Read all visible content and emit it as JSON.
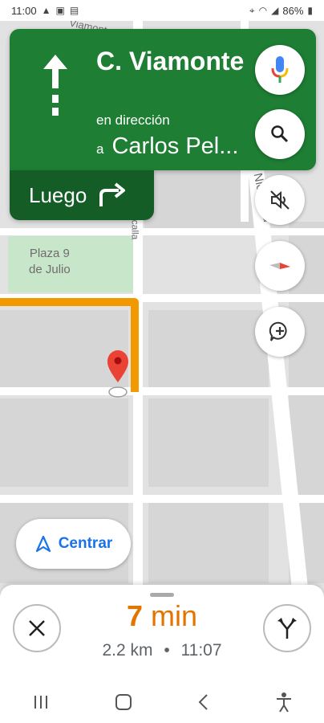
{
  "status_bar": {
    "time": "11:00",
    "battery": "86%",
    "left_icons": [
      "navigation-arrow-icon",
      "gallery-icon",
      "message-icon"
    ],
    "right_icons": [
      "location-icon",
      "wifi-icon",
      "signal-icon",
      "battery-icon"
    ]
  },
  "navigation": {
    "street_name": "C. Viamonte",
    "direction_label": "en dirección",
    "to_prefix": "a",
    "to_street": "Carlos Pel...",
    "then_label": "Luego",
    "then_icon": "turn-right-icon",
    "card_color": "#1e7e34",
    "then_color": "#155d27"
  },
  "map": {
    "labels": {
      "park_line1": "Plaza 9",
      "park_line2": "de Julio",
      "street_top": "Viamonte",
      "street_right": "Nicolás d",
      "street_left": "calla"
    },
    "route_color": "#f29900",
    "pin_color": "#ea4335"
  },
  "map_buttons": {
    "voice": "microphone-icon",
    "search": "search-icon",
    "mute": "volume-off-icon",
    "compass": "compass-icon",
    "report": "add-report-icon"
  },
  "center_button": {
    "label": "Centrar"
  },
  "trip": {
    "minutes": "7",
    "unit": "min",
    "distance": "2.2 km",
    "separator": "•",
    "arrival": "11:07",
    "eta_color": "#e37400"
  },
  "android_nav": [
    "recents-icon",
    "home-icon",
    "back-icon",
    "accessibility-icon"
  ]
}
